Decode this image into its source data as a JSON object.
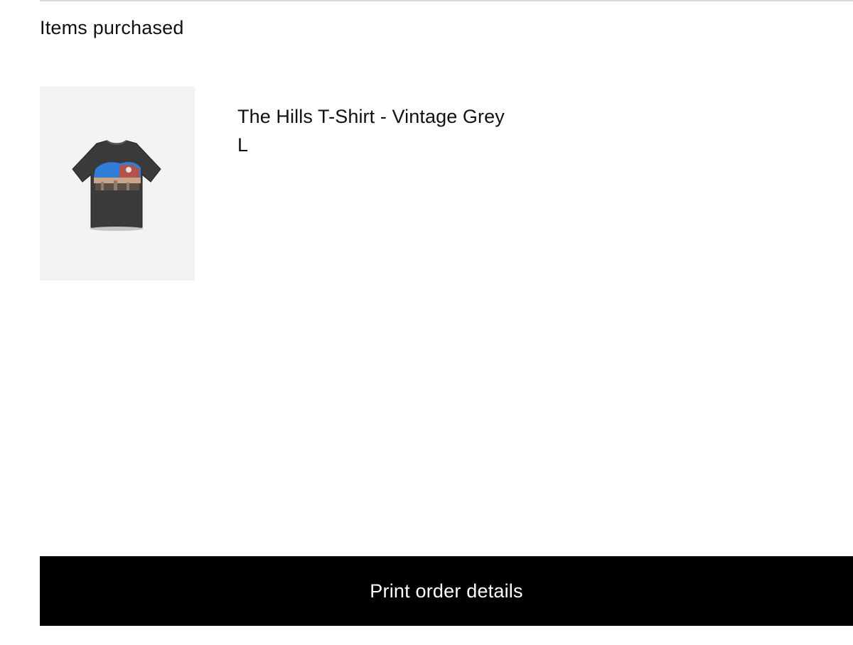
{
  "section": {
    "title": "Items purchased"
  },
  "items": [
    {
      "name": "The Hills T-Shirt - Vintage Grey",
      "size": "L",
      "thumbnail_icon": "tshirt-graphic-icon"
    }
  ],
  "actions": {
    "print_label": "Print order details"
  },
  "colors": {
    "button_background": "#000000",
    "button_text": "#ffffff",
    "thumbnail_background": "#f3f3f3",
    "divider": "#d9d9d9"
  }
}
